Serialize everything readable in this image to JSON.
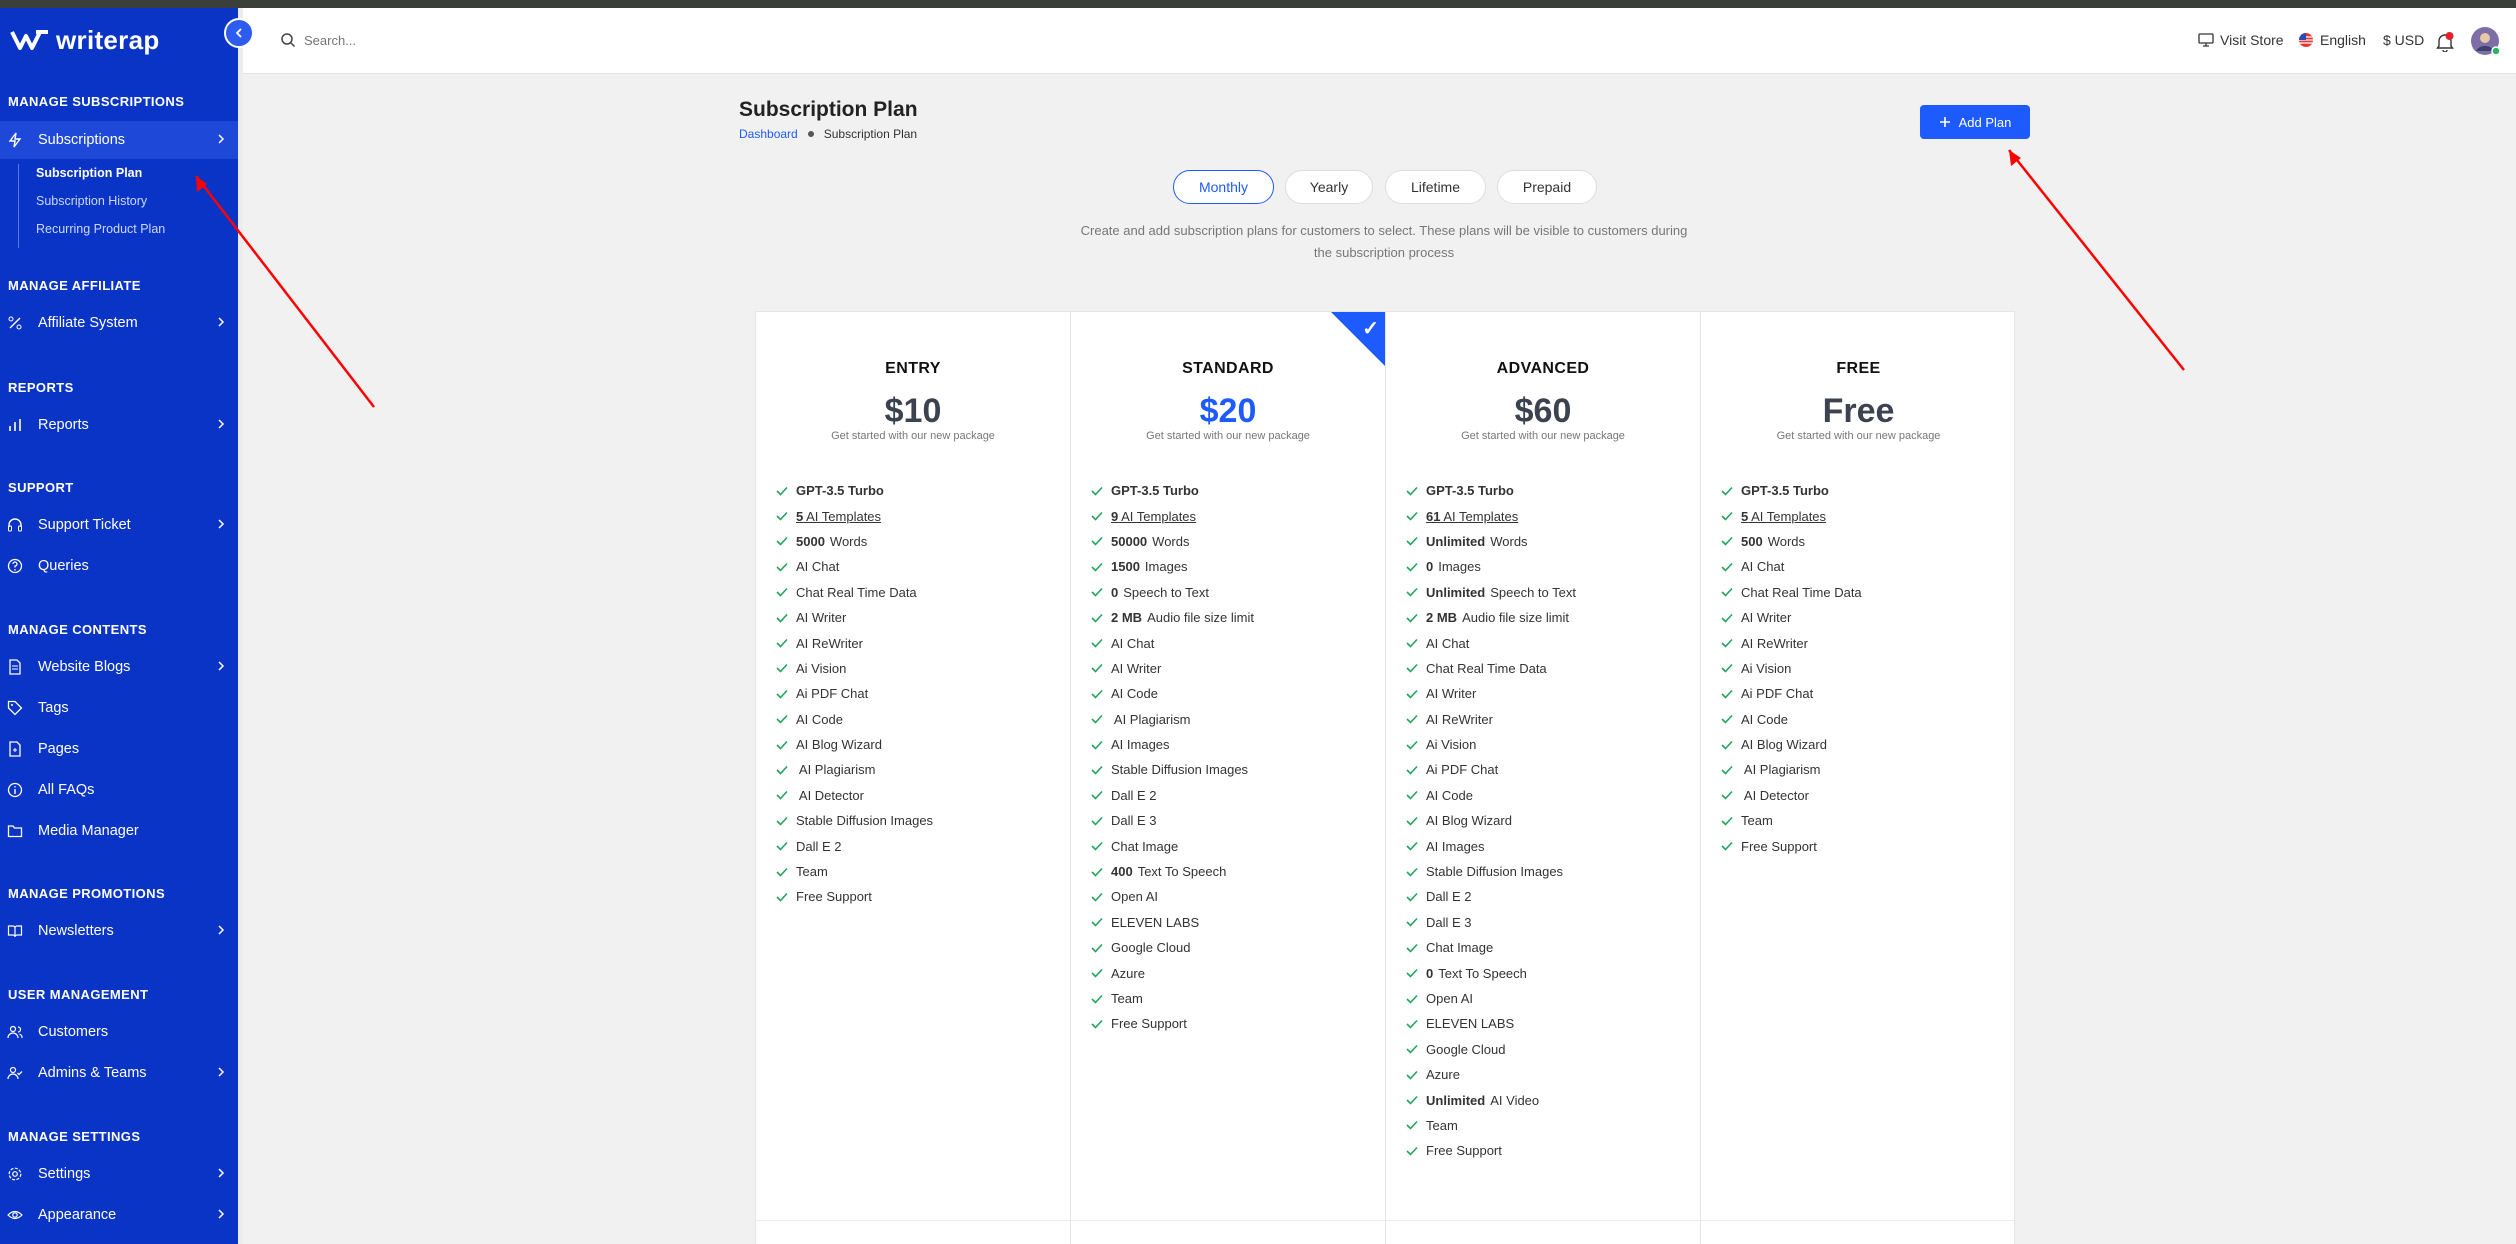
{
  "app": {
    "logo_text": "writerap"
  },
  "sidebar": {
    "sections": [
      {
        "label": "MANAGE SUBSCRIPTIONS"
      },
      {
        "label": "MANAGE AFFILIATE"
      },
      {
        "label": "REPORTS"
      },
      {
        "label": "SUPPORT"
      },
      {
        "label": "MANAGE CONTENTS"
      },
      {
        "label": "MANAGE PROMOTIONS"
      },
      {
        "label": "USER MANAGEMENT"
      },
      {
        "label": "MANAGE SETTINGS"
      }
    ],
    "items": [
      {
        "label": "Subscriptions",
        "icon": "bolt-icon"
      },
      {
        "label": "Affiliate System",
        "icon": "percent-icon"
      },
      {
        "label": "Reports",
        "icon": "bar-chart-icon"
      },
      {
        "label": "Support Ticket",
        "icon": "headset-icon"
      },
      {
        "label": "Queries",
        "icon": "question-circle-icon"
      },
      {
        "label": "Website Blogs",
        "icon": "document-icon"
      },
      {
        "label": "Tags",
        "icon": "tag-icon"
      },
      {
        "label": "Pages",
        "icon": "file-icon"
      },
      {
        "label": "All FAQs",
        "icon": "info-circle-icon"
      },
      {
        "label": "Media Manager",
        "icon": "folder-icon"
      },
      {
        "label": "Newsletters",
        "icon": "book-icon"
      },
      {
        "label": "Customers",
        "icon": "users-icon"
      },
      {
        "label": "Admins & Teams",
        "icon": "user-check-icon"
      },
      {
        "label": "Settings",
        "icon": "gear-icon"
      },
      {
        "label": "Appearance",
        "icon": "eye-icon"
      }
    ],
    "subitems": [
      {
        "label": "Subscription Plan"
      },
      {
        "label": "Subscription History"
      },
      {
        "label": "Recurring Product Plan"
      }
    ]
  },
  "topbar": {
    "search_placeholder": "Search...",
    "visit_store": "Visit Store",
    "language": "English",
    "currency": "$ USD"
  },
  "page": {
    "title": "Subscription Plan",
    "breadcrumb_home": "Dashboard",
    "breadcrumb_current": "Subscription Plan",
    "add_plan": "Add Plan",
    "description": "Create and add subscription plans for customers to select. These plans will be visible to customers during the subscription process"
  },
  "tabs": [
    {
      "label": "Monthly",
      "active": true
    },
    {
      "label": "Yearly",
      "active": false
    },
    {
      "label": "Lifetime",
      "active": false
    },
    {
      "label": "Prepaid",
      "active": false
    }
  ],
  "plans": [
    {
      "name": "ENTRY",
      "price": "$10",
      "tagline": "Get started with our new package",
      "featured": false,
      "features": [
        {
          "bold": "GPT-3.5 Turbo",
          "text": ""
        },
        {
          "bold": "5",
          "text": " AI Templates",
          "underline": true
        },
        {
          "bold": "5000",
          "text": "Words"
        },
        {
          "bold": "",
          "text": "AI Chat"
        },
        {
          "bold": "",
          "text": "Chat Real Time Data"
        },
        {
          "bold": "",
          "text": "AI Writer"
        },
        {
          "bold": "",
          "text": "AI ReWriter"
        },
        {
          "bold": "",
          "text": "Ai Vision"
        },
        {
          "bold": "",
          "text": "Ai PDF Chat"
        },
        {
          "bold": "",
          "text": "AI Code"
        },
        {
          "bold": "",
          "text": "AI Blog Wizard"
        },
        {
          "bold": "",
          "text": " AI Plagiarism"
        },
        {
          "bold": "",
          "text": " AI Detector"
        },
        {
          "bold": "",
          "text": "Stable Diffusion Images"
        },
        {
          "bold": "",
          "text": "Dall E 2"
        },
        {
          "bold": "",
          "text": "Team"
        },
        {
          "bold": "",
          "text": "Free Support"
        }
      ]
    },
    {
      "name": "STANDARD",
      "price": "$20",
      "tagline": "Get started with our new package",
      "featured": true,
      "features": [
        {
          "bold": "GPT-3.5 Turbo",
          "text": ""
        },
        {
          "bold": "9",
          "text": " AI Templates",
          "underline": true
        },
        {
          "bold": "50000",
          "text": "Words"
        },
        {
          "bold": "1500",
          "text": "Images"
        },
        {
          "bold": "0",
          "text": "Speech to Text"
        },
        {
          "bold": "2 MB",
          "text": "Audio file size limit"
        },
        {
          "bold": "",
          "text": "AI Chat"
        },
        {
          "bold": "",
          "text": "AI Writer"
        },
        {
          "bold": "",
          "text": "AI Code"
        },
        {
          "bold": "",
          "text": " AI Plagiarism"
        },
        {
          "bold": "",
          "text": "AI Images"
        },
        {
          "bold": "",
          "text": "Stable Diffusion Images"
        },
        {
          "bold": "",
          "text": "Dall E 2"
        },
        {
          "bold": "",
          "text": "Dall E 3"
        },
        {
          "bold": "",
          "text": "Chat Image"
        },
        {
          "bold": "400",
          "text": "Text To Speech"
        },
        {
          "bold": "",
          "text": "Open AI"
        },
        {
          "bold": "",
          "text": "ELEVEN LABS"
        },
        {
          "bold": "",
          "text": "Google Cloud"
        },
        {
          "bold": "",
          "text": "Azure"
        },
        {
          "bold": "",
          "text": "Team"
        },
        {
          "bold": "",
          "text": "Free Support"
        }
      ]
    },
    {
      "name": "ADVANCED",
      "price": "$60",
      "tagline": "Get started with our new package",
      "featured": false,
      "features": [
        {
          "bold": "GPT-3.5 Turbo",
          "text": ""
        },
        {
          "bold": "61",
          "text": " AI Templates",
          "underline": true
        },
        {
          "bold": "Unlimited",
          "text": "Words"
        },
        {
          "bold": "0",
          "text": "Images"
        },
        {
          "bold": "Unlimited",
          "text": "Speech to Text"
        },
        {
          "bold": "2 MB",
          "text": "Audio file size limit"
        },
        {
          "bold": "",
          "text": "AI Chat"
        },
        {
          "bold": "",
          "text": "Chat Real Time Data"
        },
        {
          "bold": "",
          "text": "AI Writer"
        },
        {
          "bold": "",
          "text": "AI ReWriter"
        },
        {
          "bold": "",
          "text": "Ai Vision"
        },
        {
          "bold": "",
          "text": "Ai PDF Chat"
        },
        {
          "bold": "",
          "text": "AI Code"
        },
        {
          "bold": "",
          "text": "AI Blog Wizard"
        },
        {
          "bold": "",
          "text": "AI Images"
        },
        {
          "bold": "",
          "text": "Stable Diffusion Images"
        },
        {
          "bold": "",
          "text": "Dall E 2"
        },
        {
          "bold": "",
          "text": "Dall E 3"
        },
        {
          "bold": "",
          "text": "Chat Image"
        },
        {
          "bold": "0",
          "text": "Text To Speech"
        },
        {
          "bold": "",
          "text": "Open AI"
        },
        {
          "bold": "",
          "text": "ELEVEN LABS"
        },
        {
          "bold": "",
          "text": "Google Cloud"
        },
        {
          "bold": "",
          "text": "Azure"
        },
        {
          "bold": "Unlimited",
          "text": "AI Video"
        },
        {
          "bold": "",
          "text": "Team"
        },
        {
          "bold": "",
          "text": "Free Support"
        }
      ]
    },
    {
      "name": "FREE",
      "price": "Free",
      "tagline": "Get started with our new package",
      "featured": false,
      "features": [
        {
          "bold": "GPT-3.5 Turbo",
          "text": ""
        },
        {
          "bold": "5",
          "text": " AI Templates",
          "underline": true
        },
        {
          "bold": "500",
          "text": "Words"
        },
        {
          "bold": "",
          "text": "AI Chat"
        },
        {
          "bold": "",
          "text": "Chat Real Time Data"
        },
        {
          "bold": "",
          "text": "AI Writer"
        },
        {
          "bold": "",
          "text": "AI ReWriter"
        },
        {
          "bold": "",
          "text": "Ai Vision"
        },
        {
          "bold": "",
          "text": "Ai PDF Chat"
        },
        {
          "bold": "",
          "text": "AI Code"
        },
        {
          "bold": "",
          "text": "AI Blog Wizard"
        },
        {
          "bold": "",
          "text": " AI Plagiarism"
        },
        {
          "bold": "",
          "text": " AI Detector"
        },
        {
          "bold": "",
          "text": "Team"
        },
        {
          "bold": "",
          "text": "Free Support"
        }
      ]
    }
  ],
  "colors": {
    "brand": "#0a34c6",
    "accent": "#1e5bff",
    "check": "#22a45d",
    "annotation": "#ff0000"
  }
}
